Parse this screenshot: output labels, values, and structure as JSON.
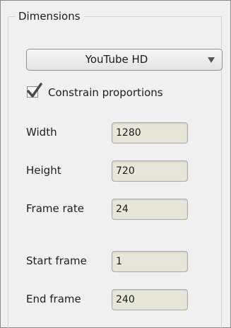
{
  "group": {
    "title": "Dimensions"
  },
  "preset": {
    "selected": "YouTube HD",
    "arrow_icon": "triangle-down"
  },
  "constrain": {
    "label": "Constrain proportions",
    "checked": true,
    "check_icon": "checkmark"
  },
  "fields": {
    "width": {
      "label": "Width",
      "value": "1280"
    },
    "height": {
      "label": "Height",
      "value": "720"
    },
    "frame_rate": {
      "label": "Frame rate",
      "value": "24"
    },
    "start_frame": {
      "label": "Start frame",
      "value": "1"
    },
    "end_frame": {
      "label": "End frame",
      "value": "240"
    }
  },
  "colors": {
    "panel_background": "#f0f0f0",
    "input_background": "#e7e6d9",
    "check_mark": "#4a4a4a"
  }
}
